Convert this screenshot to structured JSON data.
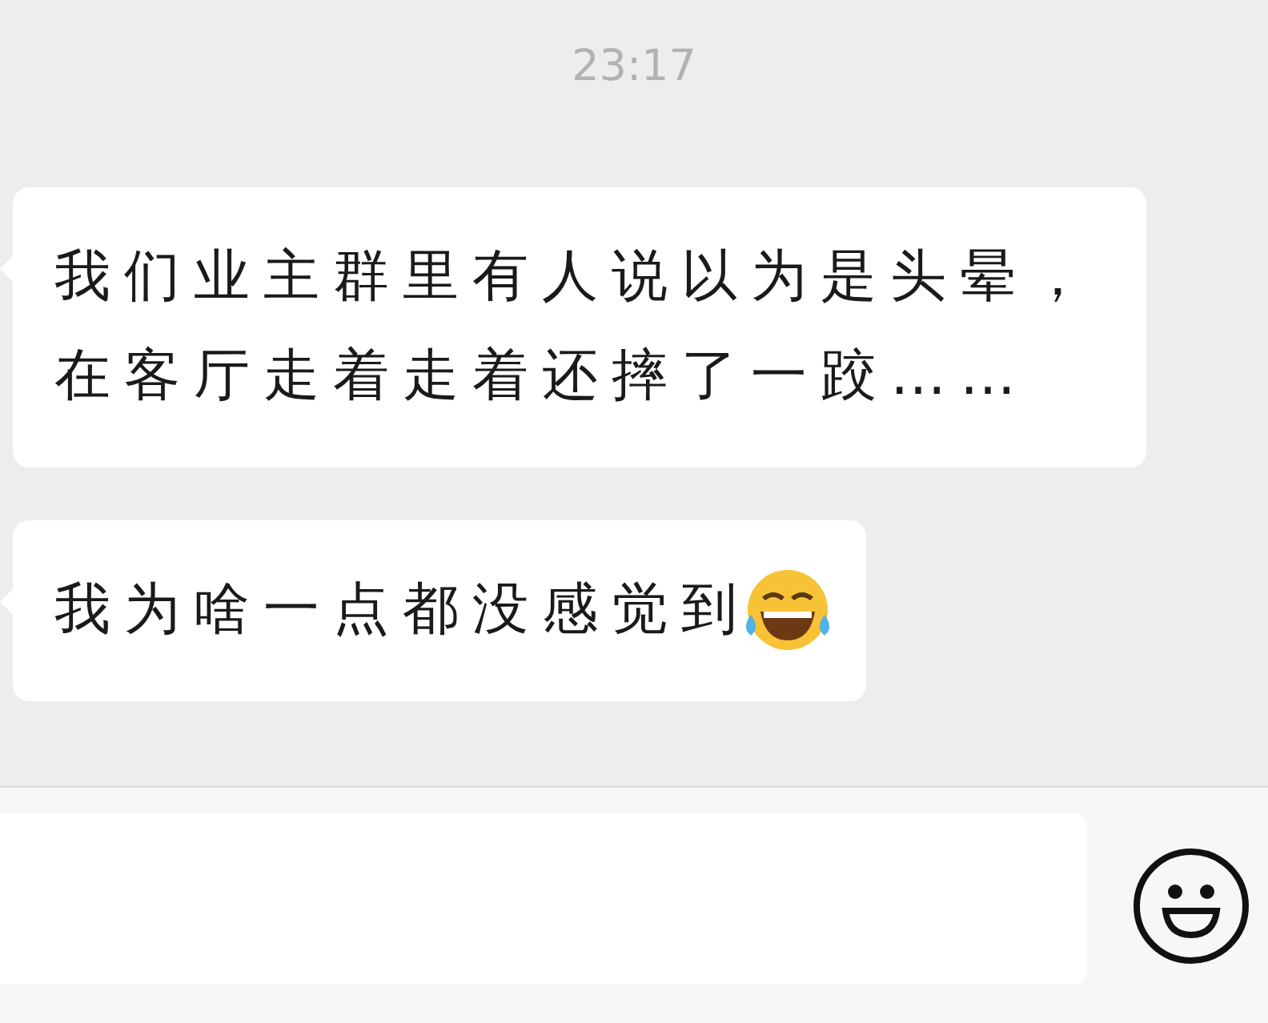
{
  "timestamp": "23:17",
  "messages": [
    {
      "text": "我们业主群里有人说以为是头晕，在客厅走着走着还摔了一跤……",
      "has_emoji": false
    },
    {
      "text": "我为啥一点都没感觉到",
      "has_emoji": true
    }
  ]
}
